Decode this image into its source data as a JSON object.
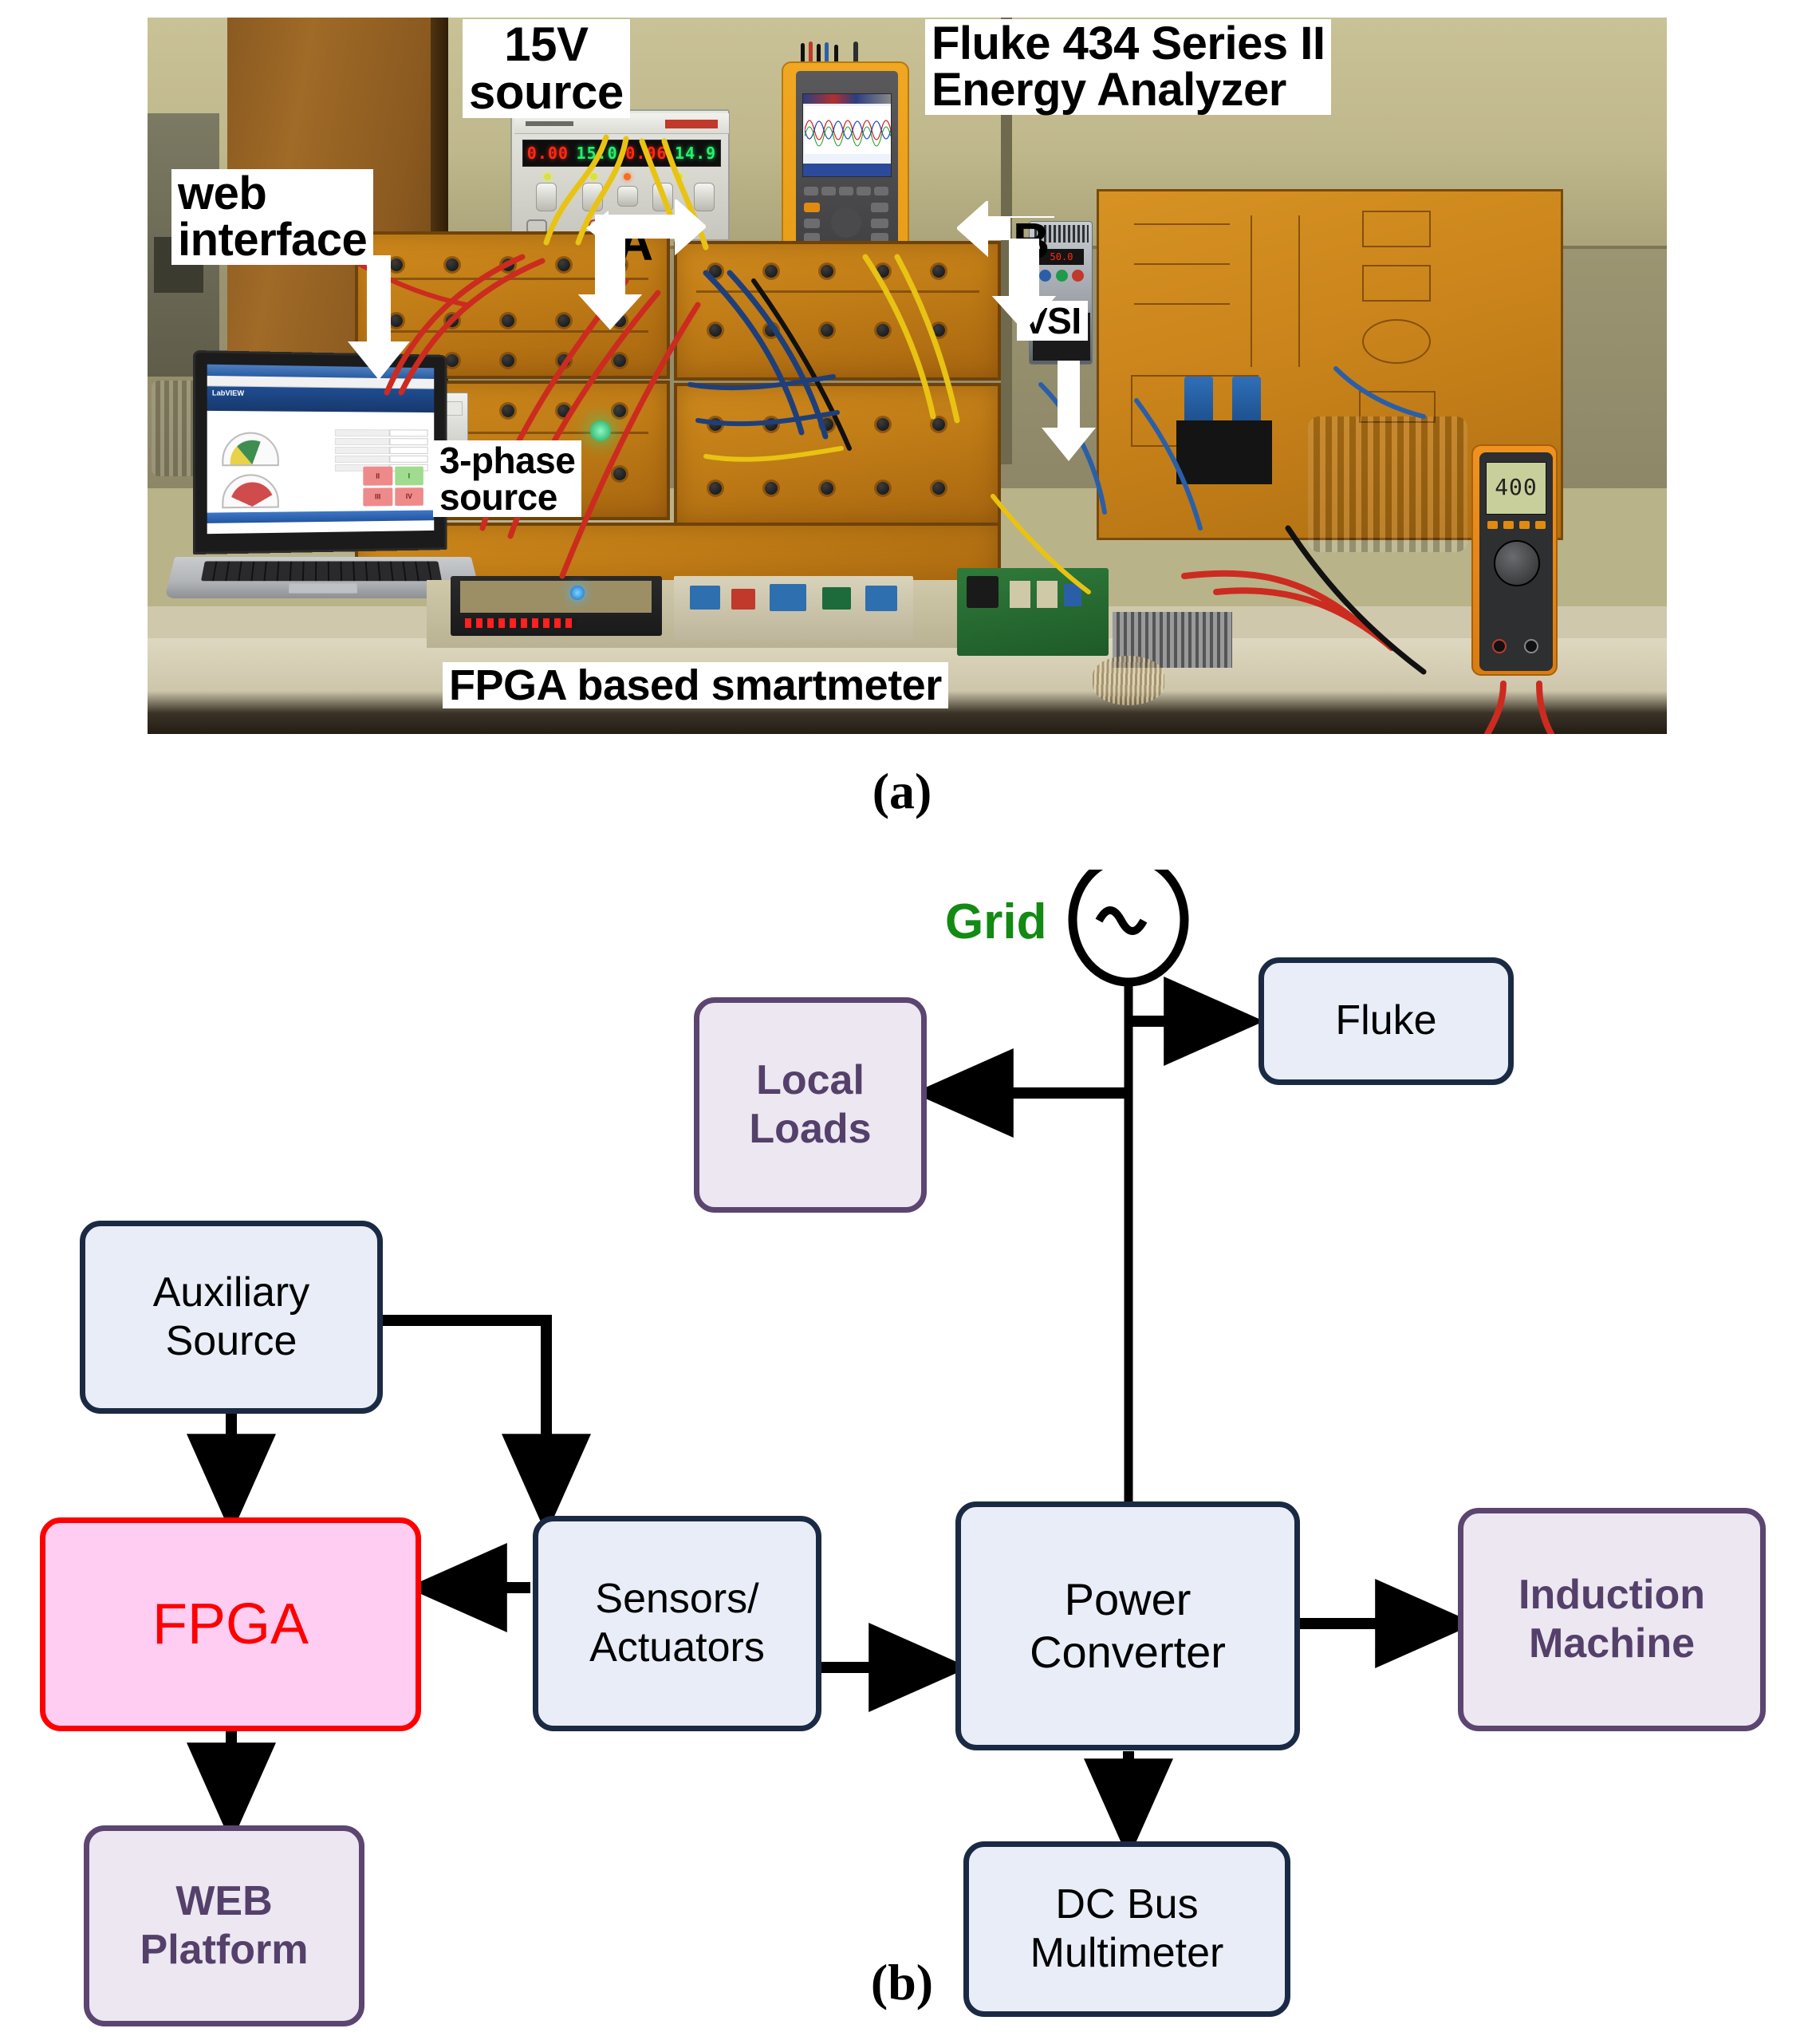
{
  "figure": {
    "caption_a": "(a)",
    "caption_b": "(b)"
  },
  "photo": {
    "labels": [
      {
        "id": "15v-source",
        "text": "15V\nsource"
      },
      {
        "id": "fluke-analyzer",
        "text": "Fluke 434 Series II\nEnergy Analyzer"
      },
      {
        "id": "web-interface",
        "text": "web\ninterface"
      },
      {
        "id": "three-phase",
        "text": "3-phase\nsource"
      },
      {
        "id": "smartmeter",
        "text": "FPGA based smartmeter"
      },
      {
        "id": "callout-a",
        "text": "A"
      },
      {
        "id": "callout-b",
        "text": "B"
      },
      {
        "id": "vsi",
        "text": "VSI"
      }
    ],
    "psu_display": [
      "0.00",
      "15.0",
      "0.06",
      "14.9"
    ],
    "vfd_display": "50.0",
    "multimeter_display": "400",
    "laptop_screen": {
      "app_title": "LabVIEW",
      "quadrants": [
        "II",
        "I",
        "III",
        "IV"
      ]
    }
  },
  "diagram": {
    "grid_label": "Grid",
    "grid_symbol": "~",
    "nodes": [
      {
        "id": "fluke",
        "label": "Fluke",
        "style": "blue"
      },
      {
        "id": "local-loads",
        "label": "Local\nLoads",
        "style": "purple"
      },
      {
        "id": "auxiliary-source",
        "label": "Auxiliary\nSource",
        "style": "blue"
      },
      {
        "id": "fpga",
        "label": "FPGA",
        "style": "pink"
      },
      {
        "id": "sensors-actuators",
        "label": "Sensors/\nActuators",
        "style": "blue"
      },
      {
        "id": "power-converter",
        "label": "Power\nConverter",
        "style": "blue"
      },
      {
        "id": "induction-machine",
        "label": "Induction\nMachine",
        "style": "purple"
      },
      {
        "id": "web-platform",
        "label": "WEB\nPlatform",
        "style": "purple"
      },
      {
        "id": "dc-bus-multimeter",
        "label": "DC Bus\nMultimeter",
        "style": "blue"
      }
    ],
    "edges": [
      {
        "from": "grid",
        "to": "fluke"
      },
      {
        "from": "grid",
        "to": "local-loads"
      },
      {
        "from": "grid",
        "to": "power-converter"
      },
      {
        "from": "auxiliary-source",
        "to": "fpga"
      },
      {
        "from": "auxiliary-source",
        "to": "sensors-actuators"
      },
      {
        "from": "sensors-actuators",
        "to": "fpga"
      },
      {
        "from": "sensors-actuators",
        "to": "power-converter"
      },
      {
        "from": "power-converter",
        "to": "induction-machine"
      },
      {
        "from": "power-converter",
        "to": "dc-bus-multimeter"
      },
      {
        "from": "fpga",
        "to": "web-platform"
      }
    ]
  },
  "colors": {
    "node_blue_fill": "#e8edf7",
    "node_blue_border": "#1b2a44",
    "node_purple_fill": "#ece7f0",
    "node_purple_border": "#5c4570",
    "node_purple_text": "#54406a",
    "node_pink_fill": "#ffccf2",
    "node_pink_border": "#ff0000",
    "grid_text": "#138a13",
    "arrow": "#000000"
  }
}
